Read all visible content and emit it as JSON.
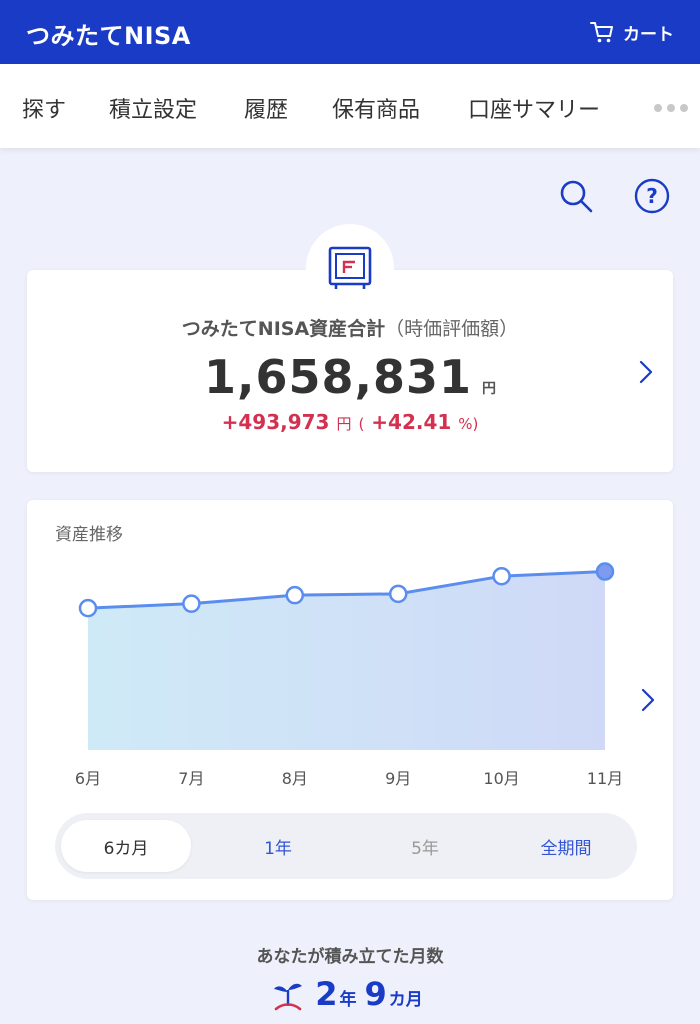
{
  "header": {
    "title": "つみたてNISA",
    "cart_label": "カート"
  },
  "nav": {
    "items": [
      "探す",
      "積立設定",
      "履歴",
      "保有商品",
      "口座サマリー"
    ]
  },
  "summary": {
    "title": "つみたてNISA資産合計",
    "title_paren": "（時価評価額）",
    "total": "1,658,831",
    "total_unit": "円",
    "gain": "+493,973",
    "gain_unit": "円",
    "gain_paren_open": "(",
    "gain_pct": "+42.41",
    "gain_pct_unit": "%)"
  },
  "chart": {
    "title": "資産推移",
    "periods": [
      "6カ月",
      "1年",
      "5年",
      "全期間"
    ],
    "selected_period": "6カ月"
  },
  "chart_data": {
    "type": "area",
    "title": "資産推移",
    "categories": [
      "6月",
      "7月",
      "8月",
      "9月",
      "10月",
      "11月"
    ],
    "values": [
      1495000,
      1515000,
      1553000,
      1559000,
      1638000,
      1658831
    ],
    "ylim": [
      860000,
      1800000
    ],
    "grid": false,
    "colors": {
      "line": "#5b8def",
      "fill_start": "#cfeaf7",
      "fill_end": "#cfd9f7",
      "point": "#5b8def",
      "last_point_fill": "#7d9cf0"
    }
  },
  "months": {
    "label": "あなたが積み立てた月数",
    "years": "2",
    "years_unit": "年",
    "months": "9",
    "months_unit": "カ月"
  },
  "colors": {
    "brand": "#1a3bc6",
    "gain": "#d3314f",
    "background": "#eef0fb"
  }
}
